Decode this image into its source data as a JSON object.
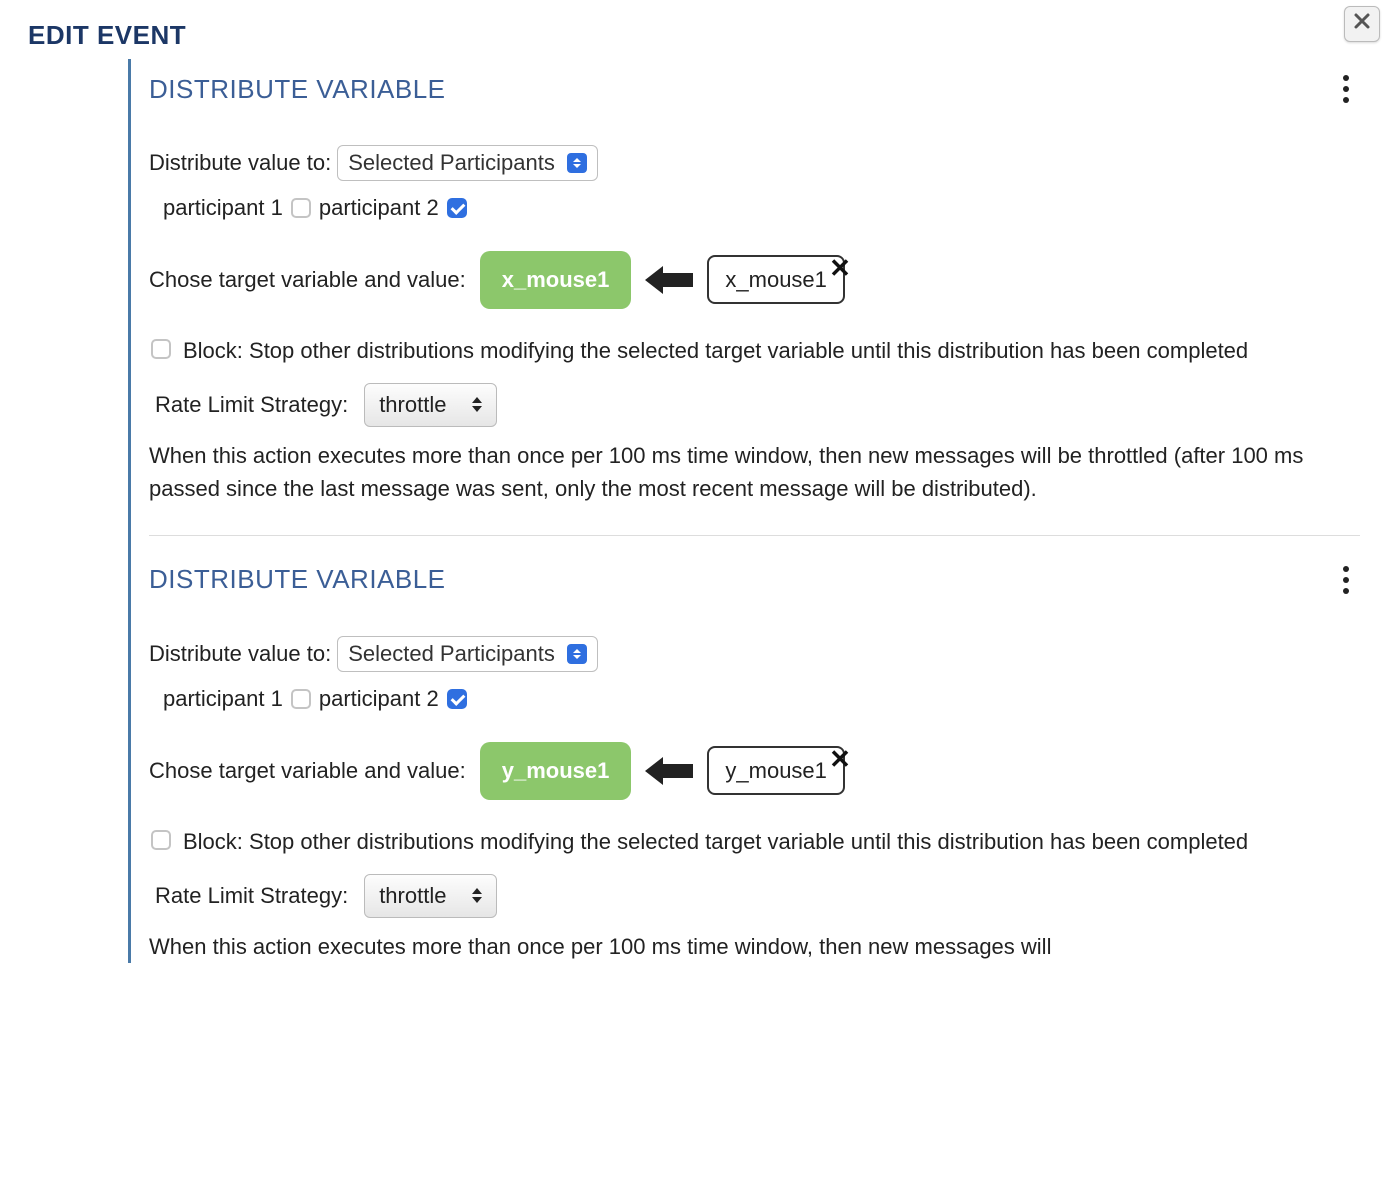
{
  "header": {
    "title": "EDIT EVENT"
  },
  "sections": [
    {
      "title": "DISTRIBUTE VARIABLE",
      "distribute_label": "Distribute value to:",
      "distribute_select": "Selected Participants",
      "participants": [
        {
          "label": "participant 1",
          "checked": false
        },
        {
          "label": "participant 2",
          "checked": true
        }
      ],
      "target_label": "Chose target variable and value:",
      "target_var": "x_mouse1",
      "source_value": "x_mouse1",
      "block_checked": false,
      "block_text": "Block: Stop other distributions modifying the selected target variable until this distribution has been completed",
      "rate_label": "Rate Limit Strategy:",
      "rate_value": "throttle",
      "rate_desc": "When this action executes more than once per 100 ms time window, then new messages will be throttled (after 100 ms passed since the last message was sent, only the most recent message will be distributed)."
    },
    {
      "title": "DISTRIBUTE VARIABLE",
      "distribute_label": "Distribute value to:",
      "distribute_select": "Selected Participants",
      "participants": [
        {
          "label": "participant 1",
          "checked": false
        },
        {
          "label": "participant 2",
          "checked": true
        }
      ],
      "target_label": "Chose target variable and value:",
      "target_var": "y_mouse1",
      "source_value": "y_mouse1",
      "block_checked": false,
      "block_text": "Block: Stop other distributions modifying the selected target variable until this distribution has been completed",
      "rate_label": "Rate Limit Strategy:",
      "rate_value": "throttle",
      "rate_desc": "When this action executes more than once per 100 ms time window, then new messages will"
    }
  ]
}
